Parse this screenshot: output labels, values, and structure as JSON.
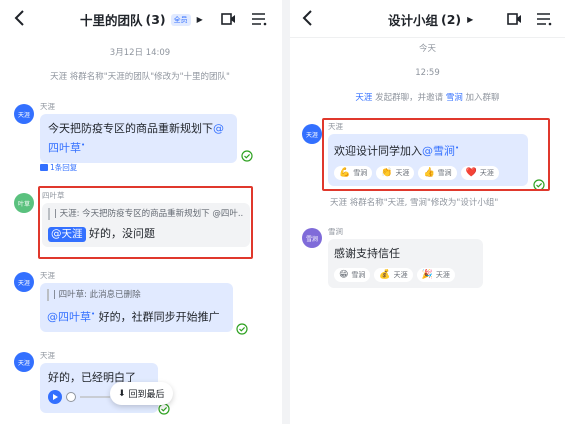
{
  "left": {
    "title": "十里的团队",
    "count": "(3)",
    "badge": "全员",
    "timestamp": "3月12日 14:09",
    "system_msg": "天涯 将群名称\"天涯的团队\"修改为\"十里的团队\"",
    "msg1": {
      "sender": "天涯",
      "avatar": "天涯",
      "text": "今天把防疫专区的商品重新规划下",
      "mention": "@四叶草",
      "reply_count": "1条回复"
    },
    "msg2": {
      "sender": "四叶草",
      "avatar": "叶草",
      "quote": "| 天涯: 今天把防疫专区的商品重新规划下 @四叶...",
      "mention": "@天涯",
      "text": " 好的，没问题"
    },
    "msg3": {
      "sender": "天涯",
      "avatar": "天涯",
      "quote": "| 四叶草: 此消息已删除",
      "mention": "@四叶草",
      "text": " 好的，社群同步开始推广"
    },
    "msg4": {
      "sender": "天涯",
      "avatar": "天涯",
      "text": "好的，已经明白了"
    },
    "jump_label": "回到最后"
  },
  "right": {
    "title": "设计小组",
    "count": "(2)",
    "date_label": "今天",
    "time_label": "12:59",
    "system_msg1": {
      "actor": "天涯",
      "mid": " 发起群聊，并邀请 ",
      "invitee": "雪涧",
      "tail": " 加入群聊"
    },
    "msg1": {
      "sender": "天涯",
      "avatar": "天涯",
      "text": "欢迎设计同学加入",
      "mention": "@雪涧",
      "reactions": [
        {
          "emoji": "💪",
          "user": "雪涧"
        },
        {
          "emoji": "👏",
          "user": "天涯"
        },
        {
          "emoji": "👍",
          "user": "雪涧"
        },
        {
          "emoji": "❤️",
          "user": "天涯"
        }
      ]
    },
    "system_msg2": "天涯 将群名称\"天涯, 雪涧\"修改为\"设计小组\"",
    "msg2": {
      "sender": "雪涧",
      "avatar": "雪涧",
      "text": "感谢支持信任",
      "reactions": [
        {
          "emoji": "😁",
          "user": "雪涧"
        },
        {
          "emoji": "💰",
          "user": "天涯"
        },
        {
          "emoji": "🎉",
          "user": "天涯"
        }
      ]
    }
  },
  "colors": {
    "accent": "#3370ff",
    "highlight_box": "#e0382c",
    "bubble": "#e1eaff",
    "check": "#2ea121"
  }
}
